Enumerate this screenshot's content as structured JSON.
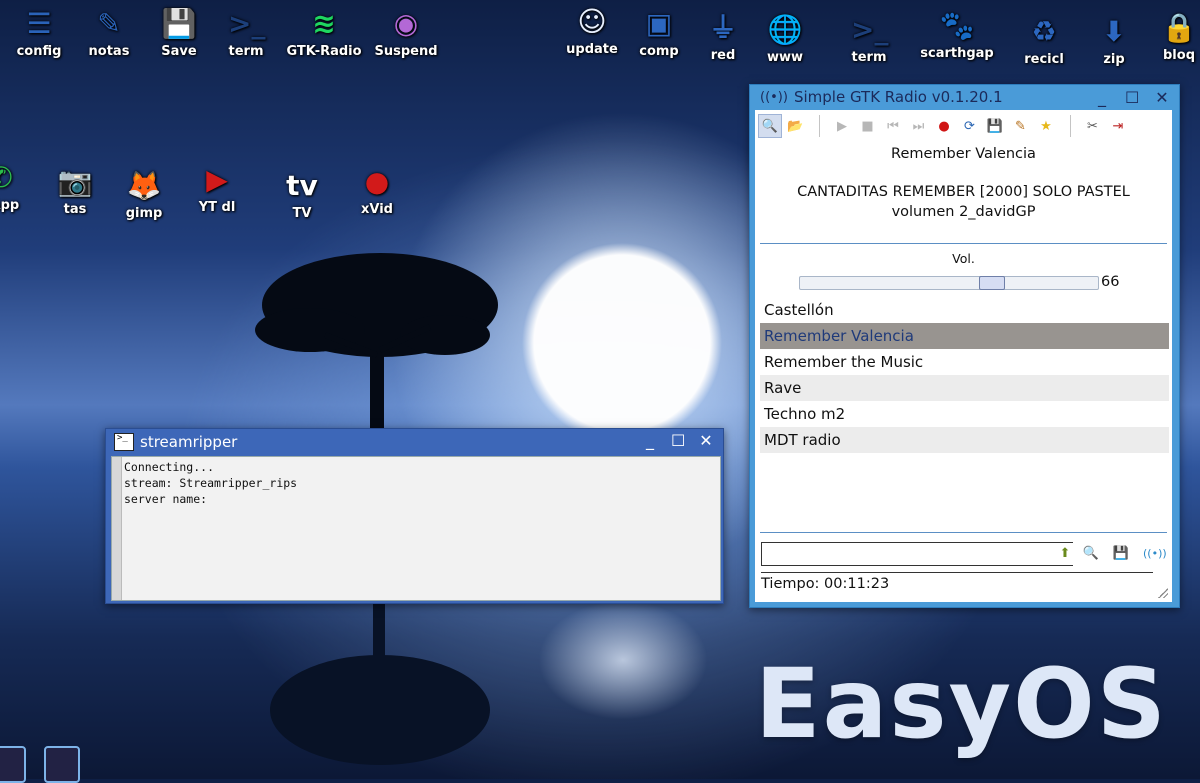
{
  "desktop": {
    "top_icons": [
      {
        "label": "config",
        "icon": "sliders-icon"
      },
      {
        "label": "notas",
        "icon": "notepad-icon"
      },
      {
        "label": "Save",
        "icon": "save-disk-icon"
      },
      {
        "label": "term",
        "icon": "terminal-icon"
      },
      {
        "label": "GTK-Radio",
        "icon": "spotify-radio-icon"
      },
      {
        "label": "Suspend",
        "icon": "suspend-icon"
      },
      {
        "label": "update",
        "icon": "update-icon"
      },
      {
        "label": "comp",
        "icon": "computer-icon"
      },
      {
        "label": "red",
        "icon": "network-plug-icon"
      },
      {
        "label": "www",
        "icon": "globe-locked-icon"
      },
      {
        "label": "term",
        "icon": "terminal-locked-icon"
      },
      {
        "label": "scarthgap",
        "icon": "puppy-locked-icon"
      },
      {
        "label": "recicl",
        "icon": "recycle-bin-icon"
      },
      {
        "label": "zip",
        "icon": "zip-box-icon"
      },
      {
        "label": "bloq",
        "icon": "padlock-icon"
      }
    ],
    "second_row_icons": [
      {
        "label": "sApp",
        "icon": "whatsapp-icon"
      },
      {
        "label": "tas",
        "icon": "camera-icon"
      },
      {
        "label": "gimp",
        "icon": "gimp-icon"
      },
      {
        "label": "YT dl",
        "icon": "youtube-icon"
      },
      {
        "label": "TV",
        "icon": "tv-icon"
      },
      {
        "label": "xVid",
        "icon": "video-record-icon"
      }
    ],
    "wallpaper_text": "EasyOS"
  },
  "streamripper": {
    "title": "streamripper",
    "controls": {
      "minimize": "_",
      "maximize": "☐",
      "close": "✕"
    },
    "output_lines": "Connecting...\nstream: Streamripper_rips\nserver name:"
  },
  "radio": {
    "title": "Simple GTK Radio v0.1.20.1",
    "controls": {
      "minimize": "_",
      "maximize": "☐",
      "close": "✕"
    },
    "toolbar": [
      {
        "name": "search-tool",
        "glyph": "🔍",
        "active": true
      },
      {
        "name": "open-folder",
        "glyph": "📂"
      },
      {
        "name": "sep"
      },
      {
        "name": "play",
        "glyph": "▶",
        "color": "#b7b7b7"
      },
      {
        "name": "stop",
        "glyph": "■",
        "color": "#b7b7b7"
      },
      {
        "name": "previous",
        "glyph": "⏮",
        "color": "#b7b7b7"
      },
      {
        "name": "next",
        "glyph": "⏭",
        "color": "#b7b7b7"
      },
      {
        "name": "record",
        "glyph": "●",
        "color": "#d01515"
      },
      {
        "name": "refresh",
        "glyph": "⟳",
        "color": "#2b66b3"
      },
      {
        "name": "save",
        "glyph": "💾",
        "color": "#1d3f86"
      },
      {
        "name": "edit",
        "glyph": "✎",
        "color": "#b6711e"
      },
      {
        "name": "favorite",
        "glyph": "★",
        "color": "#e7b81a"
      },
      {
        "name": "sep"
      },
      {
        "name": "tools",
        "glyph": "✂",
        "color": "#555"
      },
      {
        "name": "exit",
        "glyph": "⇥",
        "color": "#b22"
      }
    ],
    "now_station": "Remember Valencia",
    "now_track": "CANTADITAS REMEMBER [2000] SOLO PASTEL volumen 2_davidGP",
    "volume_label": "Vol.",
    "volume_value": 66,
    "volume_fraction": 0.66,
    "stations": [
      "Castellón",
      "Remember Valencia",
      "Remember the Music",
      "Rave",
      "Techno m2",
      "MDT radio"
    ],
    "selected_index": 1,
    "search_value": "",
    "time_text": "Tiempo: 00:11:23"
  }
}
